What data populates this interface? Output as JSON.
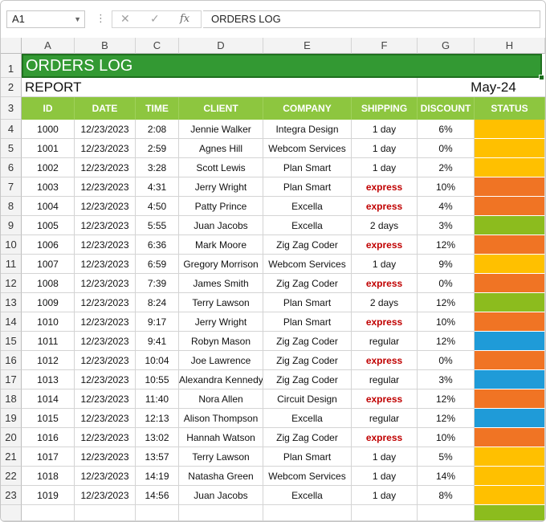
{
  "formula_bar": {
    "name_box": "A1",
    "cancel_icon": "✕",
    "enter_icon": "✓",
    "fx_label": "fx",
    "value": "ORDERS LOG"
  },
  "columns": [
    "A",
    "B",
    "C",
    "D",
    "E",
    "F",
    "G",
    "H"
  ],
  "row_numbers": [
    "1",
    "2",
    "3",
    "4",
    "5",
    "6",
    "7",
    "8",
    "9",
    "10",
    "11",
    "12",
    "13",
    "14",
    "15",
    "16",
    "17",
    "18",
    "19",
    "20",
    "21",
    "22",
    "23"
  ],
  "sheet": {
    "title": "ORDERS LOG",
    "report_label": "REPORT",
    "month": "May-24",
    "headers": [
      "ID",
      "DATE",
      "TIME",
      "CLIENT",
      "COMPANY",
      "SHIPPING",
      "DISCOUNT",
      "STATUS"
    ],
    "status_colors": {
      "yellow": "#ffc000",
      "orange": "#f07424",
      "green": "#8cbc1e",
      "blue": "#1f9bd8",
      "header_green": "#8dc63f",
      "title_green": "#339933"
    },
    "rows": [
      {
        "id": "1000",
        "date": "12/23/2023",
        "time": "2:08",
        "client": "Jennie Walker",
        "company": "Integra Design",
        "shipping": "1 day",
        "discount": "6%",
        "status": "yellow"
      },
      {
        "id": "1001",
        "date": "12/23/2023",
        "time": "2:59",
        "client": "Agnes Hill",
        "company": "Webcom Services",
        "shipping": "1 day",
        "discount": "0%",
        "status": "yellow"
      },
      {
        "id": "1002",
        "date": "12/23/2023",
        "time": "3:28",
        "client": "Scott Lewis",
        "company": "Plan Smart",
        "shipping": "1 day",
        "discount": "2%",
        "status": "yellow"
      },
      {
        "id": "1003",
        "date": "12/23/2023",
        "time": "4:31",
        "client": "Jerry Wright",
        "company": "Plan Smart",
        "shipping": "express",
        "discount": "10%",
        "status": "orange"
      },
      {
        "id": "1004",
        "date": "12/23/2023",
        "time": "4:50",
        "client": "Patty Prince",
        "company": "Excella",
        "shipping": "express",
        "discount": "4%",
        "status": "orange"
      },
      {
        "id": "1005",
        "date": "12/23/2023",
        "time": "5:55",
        "client": "Juan Jacobs",
        "company": "Excella",
        "shipping": "2 days",
        "discount": "3%",
        "status": "green"
      },
      {
        "id": "1006",
        "date": "12/23/2023",
        "time": "6:36",
        "client": "Mark Moore",
        "company": "Zig Zag Coder",
        "shipping": "express",
        "discount": "12%",
        "status": "orange"
      },
      {
        "id": "1007",
        "date": "12/23/2023",
        "time": "6:59",
        "client": "Gregory Morrison",
        "company": "Webcom Services",
        "shipping": "1 day",
        "discount": "9%",
        "status": "yellow"
      },
      {
        "id": "1008",
        "date": "12/23/2023",
        "time": "7:39",
        "client": "James Smith",
        "company": "Zig Zag Coder",
        "shipping": "express",
        "discount": "0%",
        "status": "orange"
      },
      {
        "id": "1009",
        "date": "12/23/2023",
        "time": "8:24",
        "client": "Terry Lawson",
        "company": "Plan Smart",
        "shipping": "2 days",
        "discount": "12%",
        "status": "green"
      },
      {
        "id": "1010",
        "date": "12/23/2023",
        "time": "9:17",
        "client": "Jerry Wright",
        "company": "Plan Smart",
        "shipping": "express",
        "discount": "10%",
        "status": "orange"
      },
      {
        "id": "1011",
        "date": "12/23/2023",
        "time": "9:41",
        "client": "Robyn Mason",
        "company": "Zig Zag Coder",
        "shipping": "regular",
        "discount": "12%",
        "status": "blue"
      },
      {
        "id": "1012",
        "date": "12/23/2023",
        "time": "10:04",
        "client": "Joe Lawrence",
        "company": "Zig Zag Coder",
        "shipping": "express",
        "discount": "0%",
        "status": "orange"
      },
      {
        "id": "1013",
        "date": "12/23/2023",
        "time": "10:55",
        "client": "Alexandra Kennedy",
        "company": "Zig Zag Coder",
        "shipping": "regular",
        "discount": "3%",
        "status": "blue"
      },
      {
        "id": "1014",
        "date": "12/23/2023",
        "time": "11:40",
        "client": "Nora Allen",
        "company": "Circuit Design",
        "shipping": "express",
        "discount": "12%",
        "status": "orange"
      },
      {
        "id": "1015",
        "date": "12/23/2023",
        "time": "12:13",
        "client": "Alison Thompson",
        "company": "Excella",
        "shipping": "regular",
        "discount": "12%",
        "status": "blue"
      },
      {
        "id": "1016",
        "date": "12/23/2023",
        "time": "13:02",
        "client": "Hannah Watson",
        "company": "Zig Zag Coder",
        "shipping": "express",
        "discount": "10%",
        "status": "orange"
      },
      {
        "id": "1017",
        "date": "12/23/2023",
        "time": "13:57",
        "client": "Terry Lawson",
        "company": "Plan Smart",
        "shipping": "1 day",
        "discount": "5%",
        "status": "yellow"
      },
      {
        "id": "1018",
        "date": "12/23/2023",
        "time": "14:19",
        "client": "Natasha Green",
        "company": "Webcom Services",
        "shipping": "1 day",
        "discount": "14%",
        "status": "yellow"
      },
      {
        "id": "1019",
        "date": "12/23/2023",
        "time": "14:56",
        "client": "Juan Jacobs",
        "company": "Excella",
        "shipping": "1 day",
        "discount": "8%",
        "status": "yellow"
      }
    ],
    "partial_row_status": "green"
  }
}
